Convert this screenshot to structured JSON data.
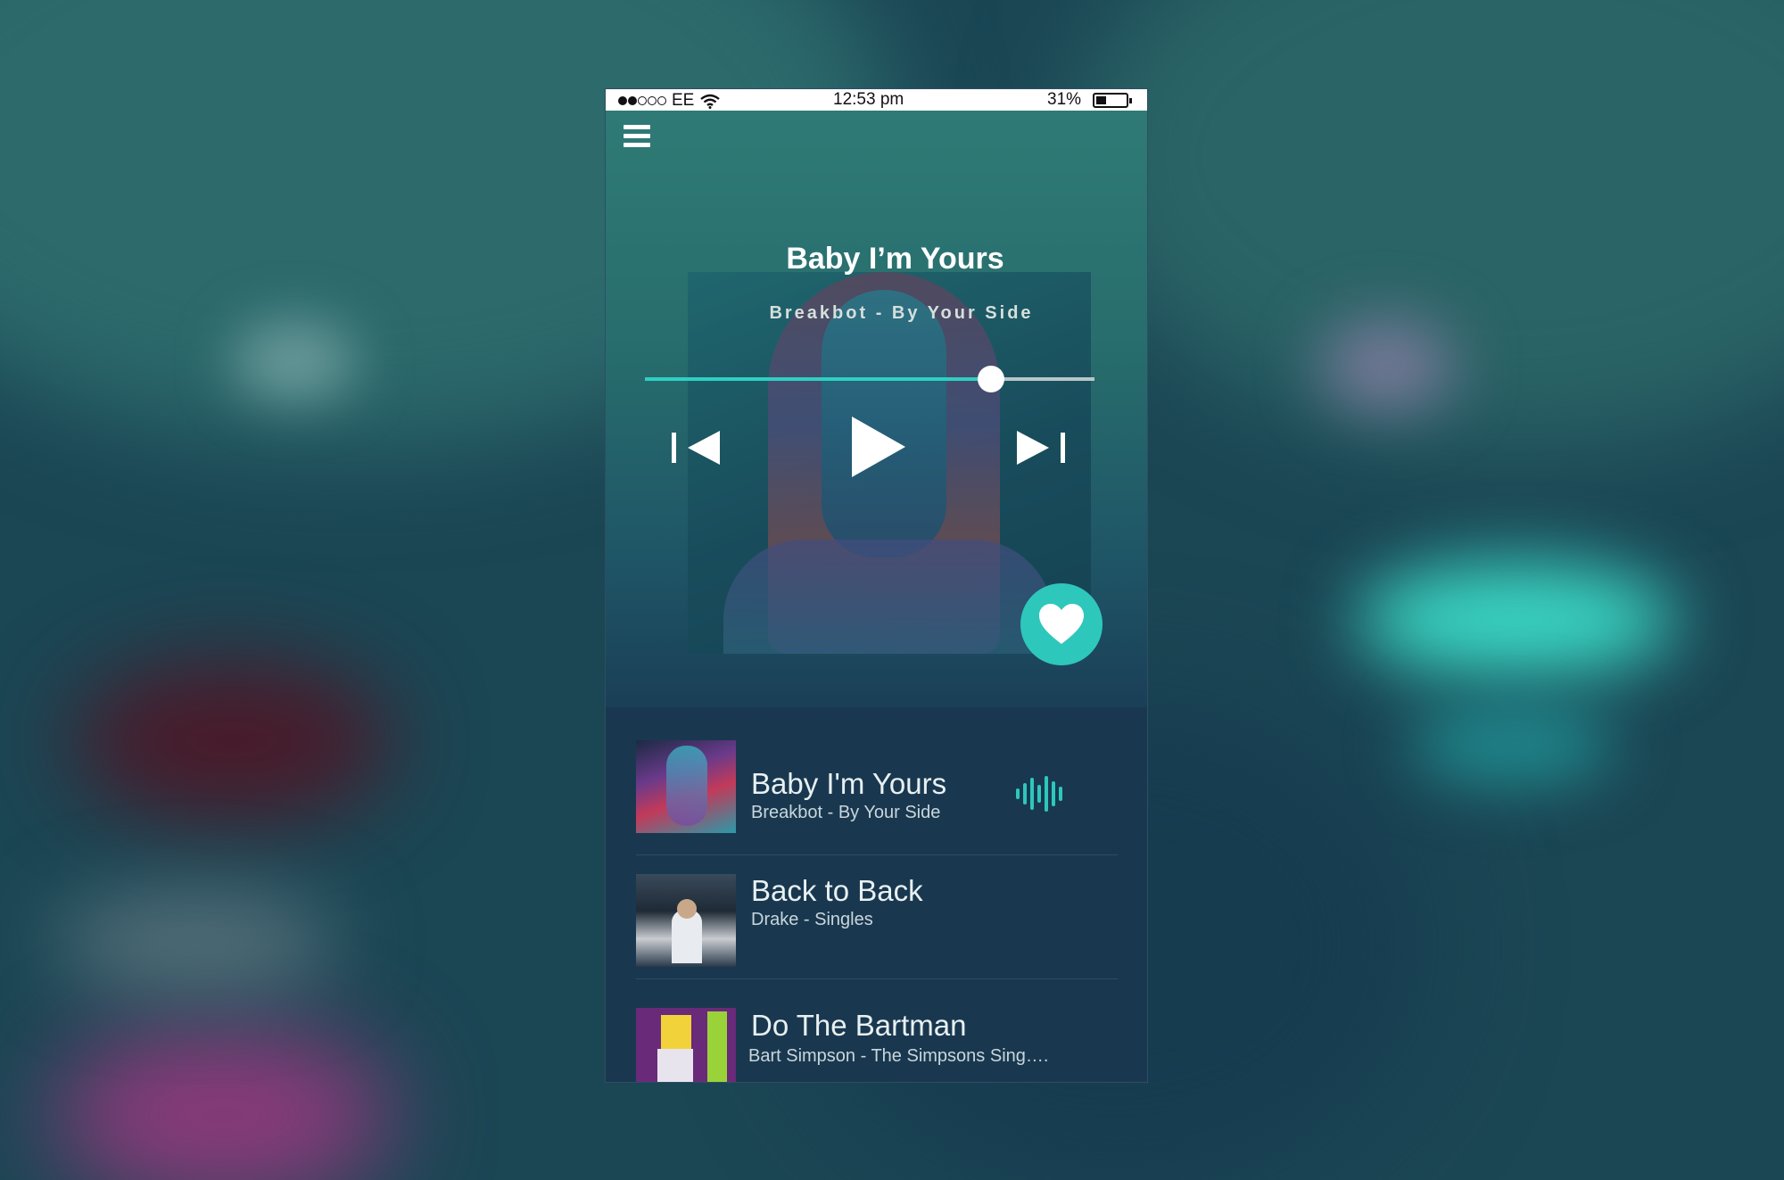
{
  "status_bar": {
    "carrier": "EE",
    "time": "12:53 pm",
    "battery": "31%",
    "battery_level": 0.31,
    "signal_bars": 2,
    "signal_total": 5
  },
  "now_playing": {
    "title": "Baby I’m Yours",
    "subtitle": "Breakbot - By Your Side",
    "progress": 0.77
  },
  "icons": {
    "menu": "hamburger-menu-icon",
    "prev": "skip-previous-icon",
    "play": "play-icon",
    "next": "skip-next-icon",
    "favorite": "heart-icon",
    "playing": "equalizer-icon",
    "wifi": "wifi-icon"
  },
  "colors": {
    "accent": "#2ec7bb",
    "panel": "#19384f",
    "text_primary": "#ffffff"
  },
  "tracks": [
    {
      "title": "Baby I'm Yours",
      "subtitle": "Breakbot - By Your Side",
      "playing": true
    },
    {
      "title": "Back to Back",
      "subtitle": "Drake - Singles",
      "playing": false
    },
    {
      "title": "Do The Bartman",
      "subtitle": "Bart Simpson - The Simpsons Sing….",
      "playing": false
    }
  ]
}
